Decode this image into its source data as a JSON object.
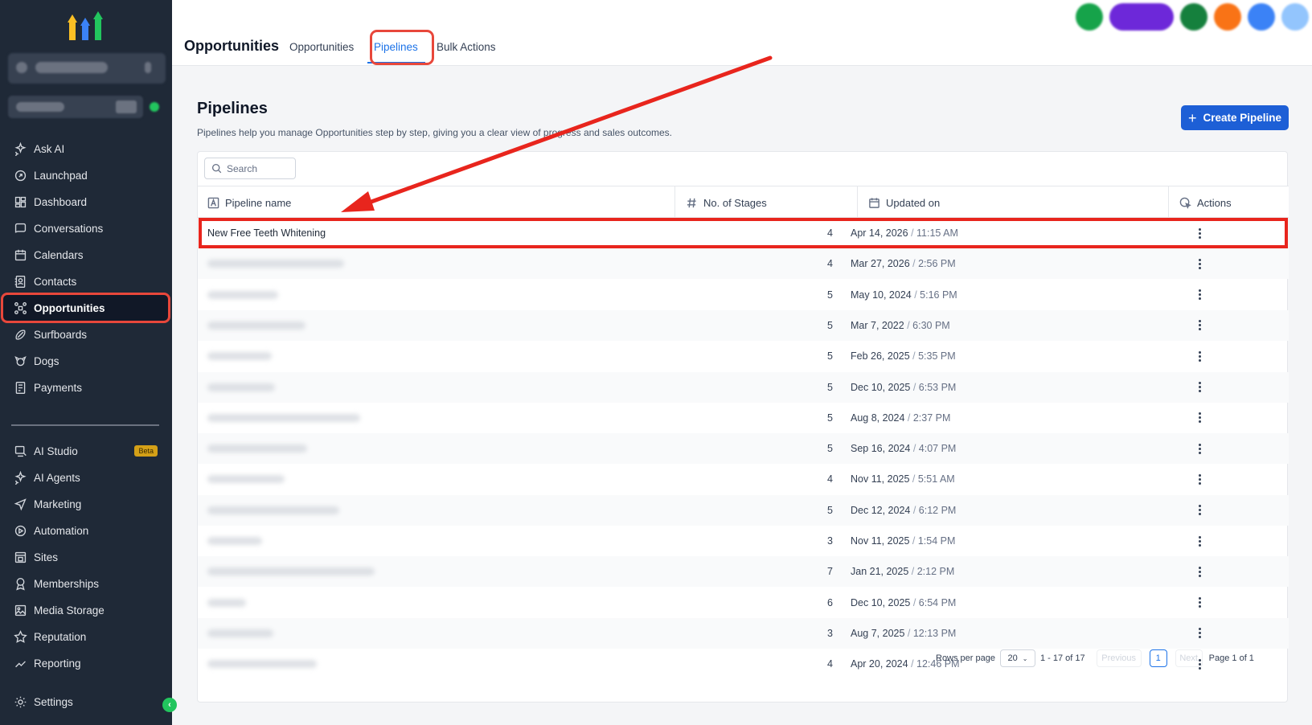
{
  "sidebar": {
    "items": [
      {
        "label": "Ask AI",
        "icon": "sparkle-icon"
      },
      {
        "label": "Launchpad",
        "icon": "rocket-icon"
      },
      {
        "label": "Dashboard",
        "icon": "dashboard-icon"
      },
      {
        "label": "Conversations",
        "icon": "chat-icon"
      },
      {
        "label": "Calendars",
        "icon": "calendar-icon"
      },
      {
        "label": "Contacts",
        "icon": "contacts-icon"
      },
      {
        "label": "Opportunities",
        "icon": "opportunities-icon",
        "active": true
      },
      {
        "label": "Surfboards",
        "icon": "surfboard-icon"
      },
      {
        "label": "Dogs",
        "icon": "dog-icon"
      },
      {
        "label": "Payments",
        "icon": "payments-icon"
      }
    ],
    "items2": [
      {
        "label": "AI Studio",
        "icon": "ai-studio-icon",
        "badge": "Beta"
      },
      {
        "label": "AI Agents",
        "icon": "sparkle-icon"
      },
      {
        "label": "Marketing",
        "icon": "send-icon"
      },
      {
        "label": "Automation",
        "icon": "automation-icon"
      },
      {
        "label": "Sites",
        "icon": "sites-icon"
      },
      {
        "label": "Memberships",
        "icon": "award-icon"
      },
      {
        "label": "Media Storage",
        "icon": "image-icon"
      },
      {
        "label": "Reputation",
        "icon": "star-icon"
      },
      {
        "label": "Reporting",
        "icon": "chart-line-icon"
      }
    ],
    "settings_label": "Settings"
  },
  "header": {
    "title": "Opportunities",
    "tabs": [
      "Opportunities",
      "Pipelines",
      "Bulk Actions"
    ],
    "active_tab": "Pipelines"
  },
  "main": {
    "title": "Pipelines",
    "description": "Pipelines help you manage Opportunities step by step, giving you a clear view of progress and sales outcomes.",
    "create_button": "Create Pipeline",
    "search_placeholder": "Search",
    "columns": [
      "Pipeline name",
      "No. of Stages",
      "Updated on",
      "Actions"
    ],
    "rows": [
      {
        "name": "New Free Teeth Whitening",
        "stages": "4",
        "date": "Apr 14, 2026",
        "time": "11:15 AM"
      },
      {
        "name": "",
        "stages": "4",
        "date": "Mar 27, 2026",
        "time": "2:56 PM"
      },
      {
        "name": "",
        "stages": "5",
        "date": "May 10, 2024",
        "time": "5:16 PM"
      },
      {
        "name": "",
        "stages": "5",
        "date": "Mar 7, 2022",
        "time": "6:30 PM"
      },
      {
        "name": "",
        "stages": "5",
        "date": "Feb 26, 2025",
        "time": "5:35 PM"
      },
      {
        "name": "",
        "stages": "5",
        "date": "Dec 10, 2025",
        "time": "6:53 PM"
      },
      {
        "name": "",
        "stages": "5",
        "date": "Aug 8, 2024",
        "time": "2:37 PM"
      },
      {
        "name": "",
        "stages": "5",
        "date": "Sep 16, 2024",
        "time": "4:07 PM"
      },
      {
        "name": "",
        "stages": "4",
        "date": "Nov 11, 2025",
        "time": "5:51 AM"
      },
      {
        "name": "",
        "stages": "5",
        "date": "Dec 12, 2024",
        "time": "6:12 PM"
      },
      {
        "name": "",
        "stages": "3",
        "date": "Nov 11, 2025",
        "time": "1:54 PM"
      },
      {
        "name": "",
        "stages": "7",
        "date": "Jan 21, 2025",
        "time": "2:12 PM"
      },
      {
        "name": "",
        "stages": "6",
        "date": "Dec 10, 2025",
        "time": "6:54 PM"
      },
      {
        "name": "",
        "stages": "3",
        "date": "Aug 7, 2025",
        "time": "12:13 PM"
      },
      {
        "name": "",
        "stages": "4",
        "date": "Apr 20, 2024",
        "time": "12:46 PM"
      }
    ],
    "pagination": {
      "rows_per_page_label": "Rows per page",
      "rows_per_page": "20",
      "range": "1 - 17 of 17",
      "previous": "Previous",
      "current_page": "1",
      "next": "Next",
      "page_of": "Page 1 of 1"
    }
  },
  "colors": {
    "accent": "#1d5fd6",
    "annotation": "#e8251d",
    "sidebar_bg": "#1f2937"
  }
}
